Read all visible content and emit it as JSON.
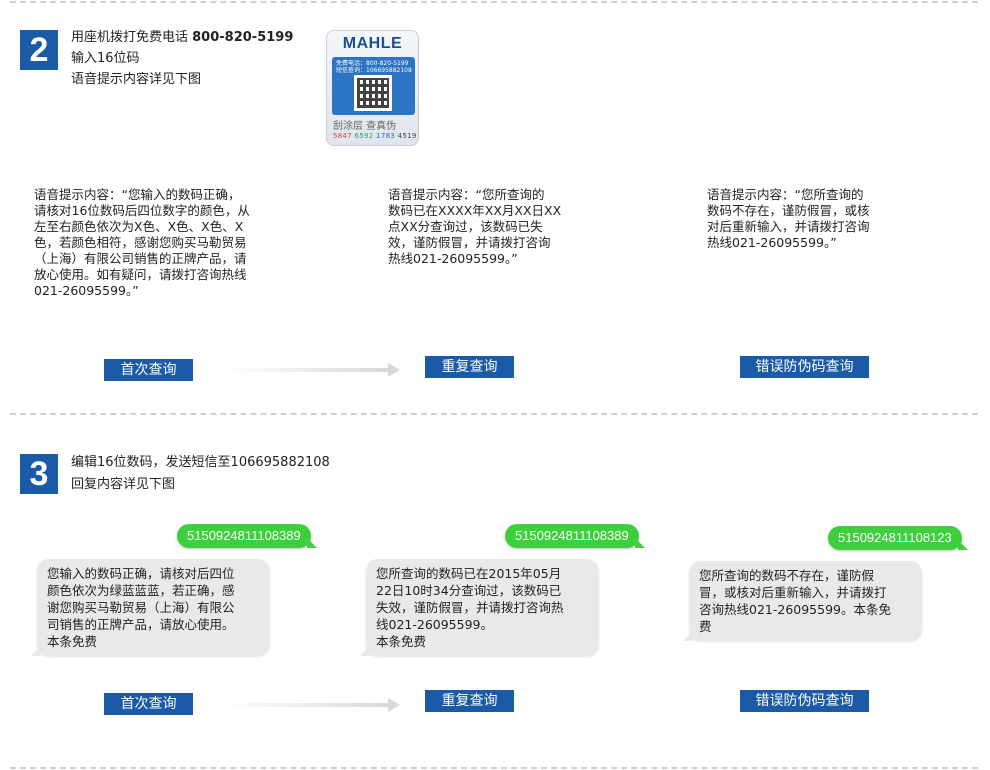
{
  "step2": {
    "number": "2",
    "line1_text": "用座机拨打免费电话 ",
    "line1_phone": "800-820-5199",
    "line2": "输入16位码",
    "line3": "语音提示内容详见下图",
    "label": {
      "brand": "MAHLE",
      "tiny1": "免费电话：800-820-5199",
      "tiny2": "短信查询：106695882108",
      "name": "刮涂层 查真伪",
      "code": [
        "5847",
        "6592",
        "1783",
        "4519"
      ]
    },
    "voice": [
      [
        "语音提示内容：“您输入的数码正确，",
        "请核对16位数码后四位数字的颜色，从",
        "左至右颜色依次为X色、X色、X色、X",
        "色，若颜色相符，感谢您购买马勒贸易",
        "（上海）有限公司销售的正牌产品，请",
        "放心使用。如有疑问，请拨打咨询热线",
        "021-26095599。”"
      ],
      [
        "语音提示内容：“您所查询的",
        "数码已在XXXX年XX月XX日XX",
        "点XX分查询过，该数码已失",
        "效，谨防假冒，并请拨打咨询",
        "热线021-26095599。”"
      ],
      [
        "语音提示内容：“您所查询的",
        "数码不存在，谨防假冒，或核",
        "对后重新输入，并请拨打咨询",
        "热线021-26095599。”"
      ]
    ],
    "buttons": [
      "首次查询",
      "重复查询",
      "错误防伪码查询"
    ]
  },
  "step3": {
    "number": "3",
    "line1": "编辑16位数码，发送短信至106695882108",
    "line2": "回复内容详见下图",
    "sms": [
      "5150924811108389",
      "5150924811108389",
      "5150924811108123"
    ],
    "replies": [
      [
        "您输入的数码正确，请核对后四位",
        "颜色依次为绿蓝蓝蓝，若正确，感",
        "谢您购买马勒贸易（上海）有限公",
        "司销售的正牌产品，请放心使用。",
        "本条免费"
      ],
      [
        "您所查询的数码已在2015年05月",
        "22日10时34分查询过，该数码已",
        "失效，谨防假冒，并请拨打咨询热",
        "线021-26095599。",
        "本条免费"
      ],
      [
        "您所查询的数码不存在，谨防假",
        "冒，或核对后重新输入，并请拨打",
        "咨询热线021-26095599。本条免",
        "费"
      ]
    ],
    "buttons": [
      "首次查询",
      "重复查询",
      "错误防伪码查询"
    ]
  },
  "colors": {
    "accent": "#1a5aa6",
    "sms_green": "#3dcf3d",
    "bubble_gray": "#e9e9ec"
  }
}
